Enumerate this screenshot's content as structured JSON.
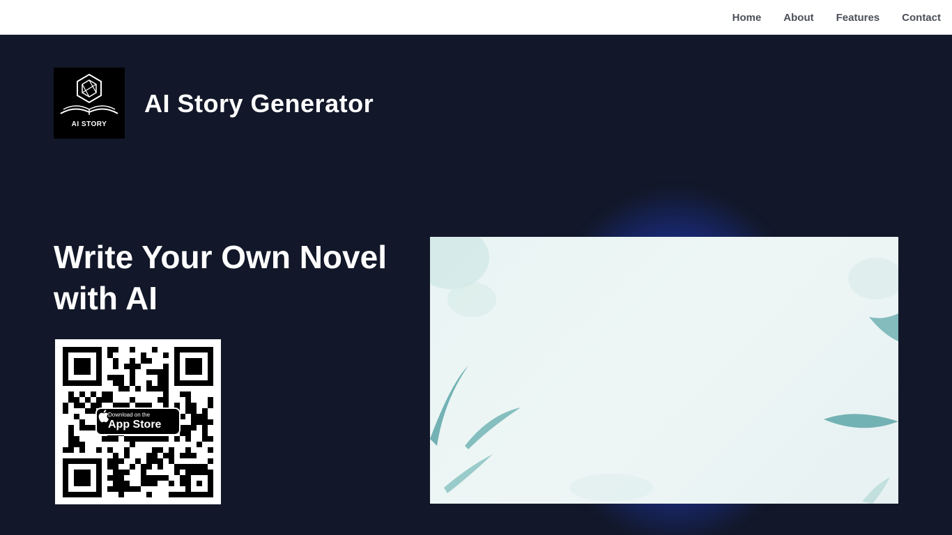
{
  "nav": {
    "items": [
      "Home",
      "About",
      "Features",
      "Contact"
    ]
  },
  "brand": {
    "logo_text": "AI STORY",
    "title": "AI Story Generator"
  },
  "hero": {
    "headline": "Write Your Own Novel with AI"
  },
  "app_store_badge": {
    "small": "Download on the",
    "big": "App Store"
  },
  "colors": {
    "background": "#121829",
    "accent_glow": "#2B4BE6",
    "panel": "#E8F4F3"
  },
  "icons": {
    "logo": "book-hexagon-logo",
    "apple": "apple-icon",
    "qr": "qr-code"
  }
}
